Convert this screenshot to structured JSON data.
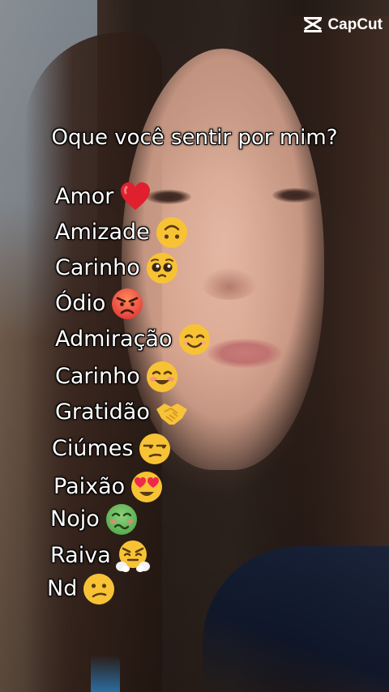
{
  "watermark": {
    "brand": "CapCut",
    "icon": "capcut-logo-icon"
  },
  "question": "Oque você sentir por mim?",
  "options": [
    {
      "label": "Amor",
      "icon": "red-heart-icon"
    },
    {
      "label": "Amizade",
      "icon": "upside-down-face-icon"
    },
    {
      "label": "Carinho",
      "icon": "pleading-face-icon"
    },
    {
      "label": "Ódio",
      "icon": "angry-face-icon"
    },
    {
      "label": "Admiração",
      "icon": "smiling-face-icon"
    },
    {
      "label": "Carinho",
      "icon": "blushing-smile-icon"
    },
    {
      "label": "Gratidão",
      "icon": "handshake-icon"
    },
    {
      "label": "Ciúmes",
      "icon": "unamused-face-icon"
    },
    {
      "label": "Paixão",
      "icon": "heart-eyes-face-icon"
    },
    {
      "label": "Nojo",
      "icon": "nauseated-face-icon"
    },
    {
      "label": "Raiva",
      "icon": "steam-nose-face-icon"
    },
    {
      "label": "Nd",
      "icon": "confused-face-icon"
    }
  ],
  "colors": {
    "text": "#ffffff",
    "emoji_yellow": "#f7c335",
    "heart_red": "#e0202e"
  }
}
